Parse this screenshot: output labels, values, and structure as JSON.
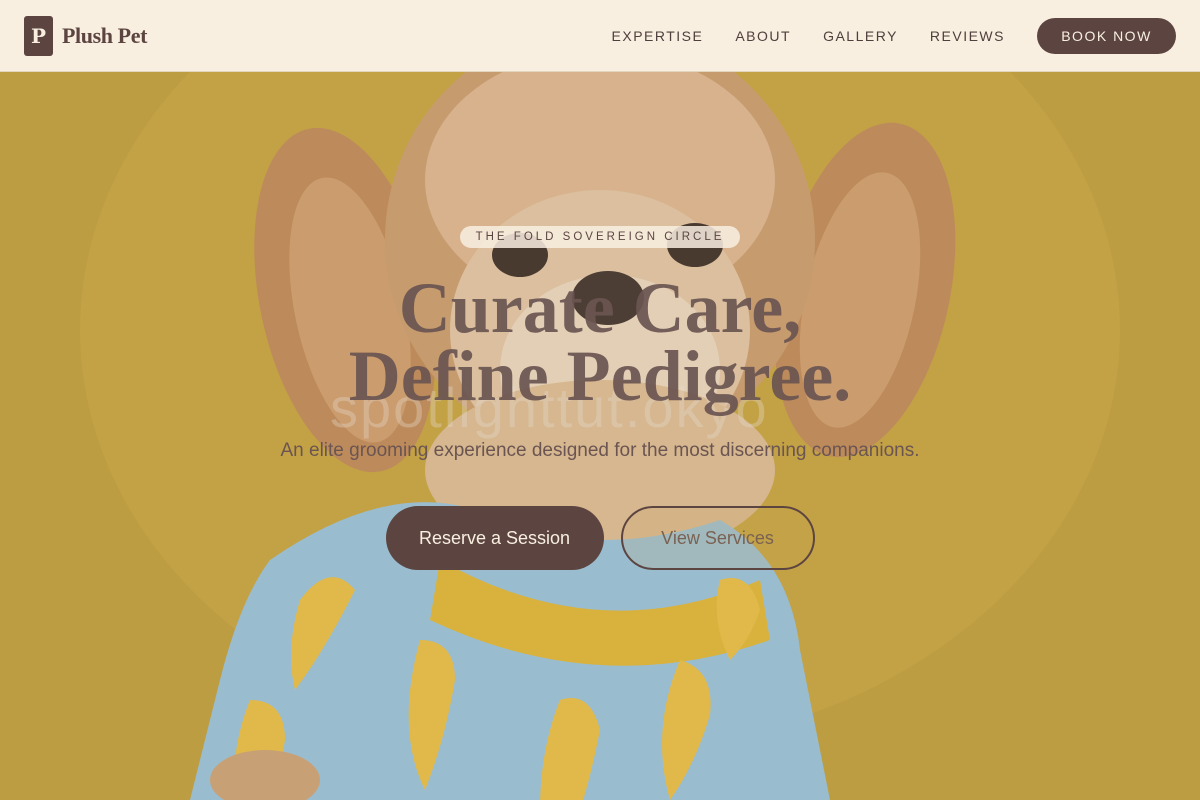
{
  "brand": {
    "mark": "P",
    "name": "Plush Pet"
  },
  "nav": {
    "links": [
      "EXPERTISE",
      "ABOUT",
      "GALLERY",
      "REVIEWS"
    ],
    "cta": "BOOK NOW"
  },
  "hero": {
    "eyebrow": "THE FOLD SOVEREIGN CIRCLE",
    "headline_line1": "Curate Care,",
    "headline_line2": "Define Pedigree.",
    "subtitle": "An elite grooming experience designed for the most discerning companions.",
    "primary_cta": "Reserve a Session",
    "secondary_cta": "View Services",
    "watermark": "spotlighttut.okyo",
    "background_icon": "dog-photo-icon"
  },
  "colors": {
    "brand_brown": "#5c4541",
    "cream": "#f8efe0",
    "mustard_backdrop": "#b8962e",
    "shirt_blue": "#8fc0e0",
    "banana_yellow": "#e8c24a"
  }
}
